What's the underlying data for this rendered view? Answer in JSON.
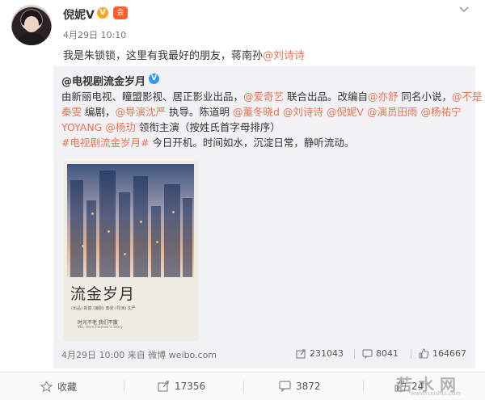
{
  "header": {
    "username": "倪妮V",
    "vip_badge": "V",
    "member_badge": "会",
    "timestamp": "4月29日 10:10"
  },
  "post": {
    "text_before": "我是朱锁锁，这里有我最好的朋友，蒋南孙",
    "mention": "@刘诗诗"
  },
  "repost": {
    "author": "@电视剧流金岁月",
    "verified_badge": "V",
    "lines": [
      [
        {
          "t": "由新丽电视、瞳盟影视、居正影业出品，",
          "h": false
        },
        {
          "t": "@爱奇艺",
          "h": true
        },
        {
          "t": " 联合出品。改编自",
          "h": false
        },
        {
          "t": "@亦舒",
          "h": true
        },
        {
          "t": " 同名小说，",
          "h": false
        },
        {
          "t": "@不是",
          "h": true
        }
      ],
      [
        {
          "t": "秦雯",
          "h": true
        },
        {
          "t": " 编剧，",
          "h": false
        },
        {
          "t": "@导演沈严",
          "h": true
        },
        {
          "t": " 执导。陈道明 ",
          "h": false
        },
        {
          "t": "@董冬晓d",
          "h": true
        },
        {
          "t": " ",
          "h": false
        },
        {
          "t": "@刘诗诗",
          "h": true
        },
        {
          "t": " ",
          "h": false
        },
        {
          "t": "@倪妮V",
          "h": true
        },
        {
          "t": " ",
          "h": false
        },
        {
          "t": "@演员田雨",
          "h": true
        },
        {
          "t": " ",
          "h": false
        },
        {
          "t": "@杨祐宁",
          "h": true
        }
      ],
      [
        {
          "t": "YOYANG",
          "h": true
        },
        {
          "t": " ",
          "h": false
        },
        {
          "t": "@杨玏",
          "h": true
        },
        {
          "t": " 领衔主演（按姓氏首字母排序）",
          "h": false
        }
      ],
      [
        {
          "t": "#电视剧流金岁月#",
          "h": true
        },
        {
          "t": " 今日开机。时间如水，沉淀日常，静听流动。",
          "h": false
        }
      ]
    ],
    "poster": {
      "title": "流金岁月",
      "credits": "(出品) 新丽 (编剧) 秦雯 (导演) 沈严",
      "tagline": "时光不老  我们不散",
      "subtag": "We, Here Forever's Story"
    },
    "footer_time": "4月29日 10:00 来自 微博 weibo.com",
    "stats": {
      "reposts": "231043",
      "comments": "8041",
      "likes": "164667"
    }
  },
  "actions": {
    "favorite": "收藏",
    "repost": "17356",
    "comment": "3872",
    "like": "24"
  },
  "watermark": {
    "text": "若水网",
    "sub": "www.ruoshui.com"
  },
  "colors": {
    "accent": "#eb7350",
    "repost_bg": "#f2f2f5",
    "verified": "#3399ea"
  }
}
